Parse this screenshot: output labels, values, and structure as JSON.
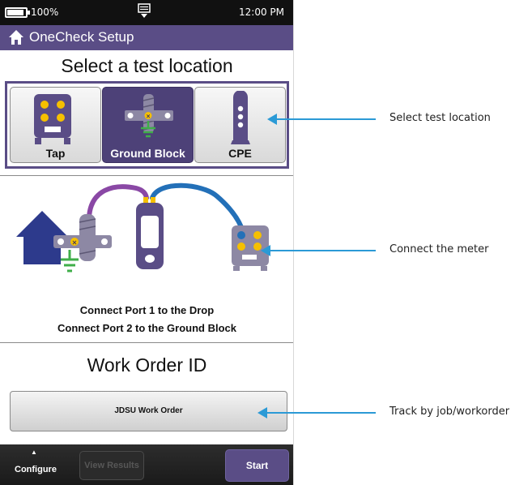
{
  "status_bar": {
    "battery": "100%",
    "time": "12:00 PM",
    "notification_icon": "notification-tray-icon"
  },
  "title_bar": {
    "home_icon": "home-icon",
    "title": "OneCheck Setup"
  },
  "location": {
    "heading": "Select a test location",
    "options": [
      {
        "label": "Tap",
        "icon": "tap-icon",
        "selected": false
      },
      {
        "label": "Ground Block",
        "icon": "ground-block-icon",
        "selected": true
      },
      {
        "label": "CPE",
        "icon": "cpe-icon",
        "selected": false
      }
    ]
  },
  "instructions": {
    "line1": "Connect Port 1 to the Drop",
    "line2": "Connect Port 2 to the Ground Block"
  },
  "work_order": {
    "heading": "Work Order ID",
    "button_label": "JDSU Work Order"
  },
  "bottom_bar": {
    "configure": "Configure",
    "view_results": "View Results",
    "start": "Start"
  },
  "callouts": {
    "location": "Select test location",
    "meter": "Connect the meter",
    "track": "Track by job/workorder"
  },
  "colors": {
    "brand_purple": "#5a4d86",
    "accent_yellow": "#f5c000",
    "ground_green": "#3fae49",
    "callout_blue": "#2b9ad6",
    "cable_purple": "#8a48a5",
    "cable_blue": "#2370b8",
    "house_blue": "#2d3a8c"
  }
}
